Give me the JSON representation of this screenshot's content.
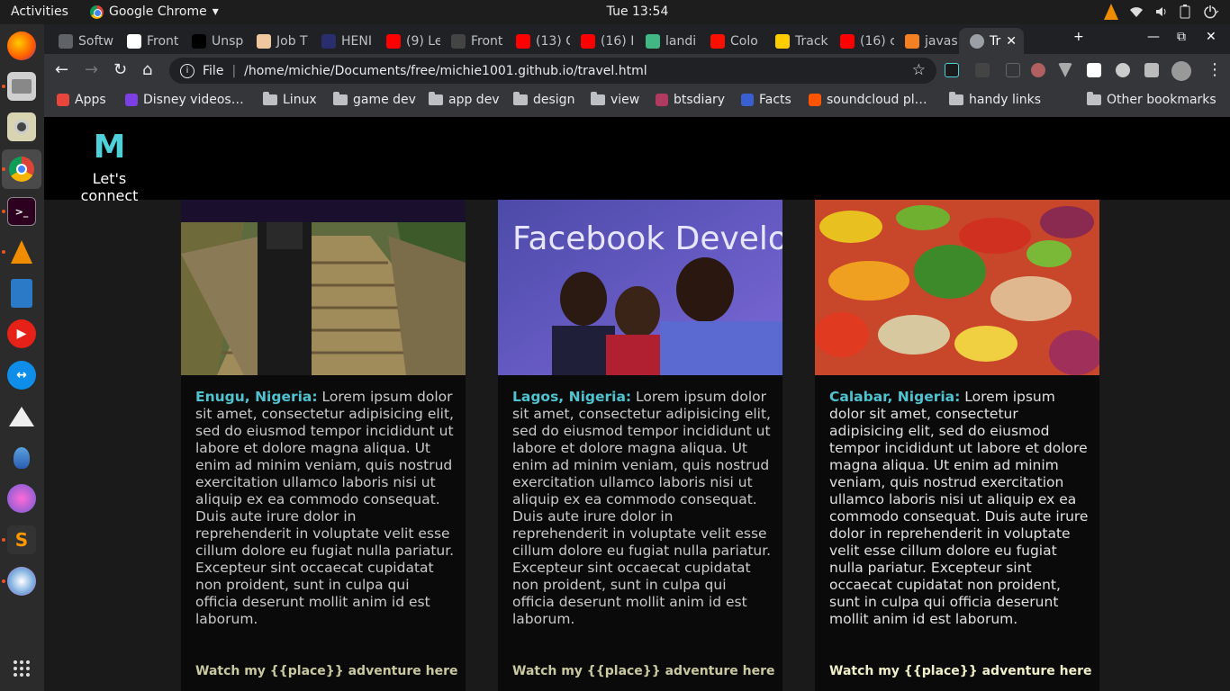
{
  "topbar": {
    "activities": "Activities",
    "app_name": "Google Chrome",
    "app_menu_arrow": "▾",
    "clock": "Tue 13:54"
  },
  "dock": {
    "items": [
      "firefox-icon",
      "files-icon",
      "rhythmbox-icon",
      "chrome-icon",
      "terminal-icon",
      "vlc-icon",
      "libreoffice-writer-icon",
      "youtube-music-icon",
      "teamviewer-icon",
      "inkscape-icon",
      "anydesk-icon",
      "gimp-icon",
      "sublime-text-icon",
      "gimp-alt-icon",
      "show-apps-icon"
    ]
  },
  "tabs": [
    {
      "label": "Softw",
      "color": "#5f6368"
    },
    {
      "label": "Front",
      "color": "#ffffff"
    },
    {
      "label": "Unsp",
      "color": "#000000"
    },
    {
      "label": "Job T",
      "color": "#f1c7a0"
    },
    {
      "label": "HENI",
      "color": "#2a2d6e"
    },
    {
      "label": "(9) Le",
      "color": "#ff0000"
    },
    {
      "label": "Front",
      "color": "#444444"
    },
    {
      "label": "(13) C",
      "color": "#ff0000"
    },
    {
      "label": "(16) I",
      "color": "#ff0000"
    },
    {
      "label": "landi",
      "color": "#41b883"
    },
    {
      "label": "Colo",
      "color": "#fa0f00"
    },
    {
      "label": "Track",
      "color": "#ffcc00"
    },
    {
      "label": "(16) c",
      "color": "#ff0000"
    },
    {
      "label": "javas",
      "color": "#f48024"
    },
    {
      "label": "Tr",
      "color": "#9aa0a6",
      "active": true
    }
  ],
  "tab_close": "✕",
  "new_tab": "+",
  "window_controls": {
    "minimize": "—",
    "restore": "⧉",
    "close": "✕"
  },
  "toolbar": {
    "back": "←",
    "forward": "→",
    "reload": "↻",
    "home": "⌂",
    "info": "i",
    "scheme": "File",
    "separator": "|",
    "url": "/home/michie/Documents/free/michie1001.github.io/travel.html",
    "star": "☆"
  },
  "bookmarks": [
    {
      "label": "Apps",
      "icon": "apps-grid-icon"
    },
    {
      "label": "Disney videos…",
      "icon": "disney-icon"
    },
    {
      "label": "Linux",
      "icon": "folder-icon"
    },
    {
      "label": "game dev",
      "icon": "folder-icon"
    },
    {
      "label": "app dev",
      "icon": "folder-icon"
    },
    {
      "label": "design",
      "icon": "folder-icon"
    },
    {
      "label": "view",
      "icon": "folder-icon"
    },
    {
      "label": "btsdiary",
      "icon": "btsdiary-icon"
    },
    {
      "label": "Facts",
      "icon": "facts-icon"
    },
    {
      "label": "soundcloud pl…",
      "icon": "soundcloud-icon"
    },
    {
      "label": "handy links",
      "icon": "folder-icon"
    },
    {
      "label": "Other bookmarks",
      "icon": "folder-icon"
    }
  ],
  "site": {
    "logo_letter": "M",
    "tagline": "Let's connect"
  },
  "cards": [
    {
      "place": "Enugu, Nigeria:",
      "body": " Lorem ipsum dolor sit amet, consectetur adipisicing elit, sed do eiusmod tempor incididunt ut labore et dolore magna aliqua. Ut enim ad minim veniam, quis nostrud exercitation ullamco laboris nisi ut aliquip ex ea commodo consequat. Duis aute irure dolor in reprehenderit in voluptate velit esse cillum dolore eu fugiat nulla pariatur. Excepteur sint occaecat cupidatat non proident, sunt in culpa qui officia deserunt mollit anim id est laborum.",
      "cta": "Watch my {{place}} adventure here",
      "photo_icon": "boardwalk-photo"
    },
    {
      "place": "Lagos, Nigeria:",
      "body": " Lorem ipsum dolor sit amet, consectetur adipisicing elit, sed do eiusmod tempor incididunt ut labore et dolore magna aliqua. Ut enim ad minim veniam, quis nostrud exercitation ullamco laboris nisi ut aliquip ex ea commodo consequat. Duis aute irure dolor in reprehenderit in voluptate velit esse cillum dolore eu fugiat nulla pariatur. Excepteur sint occaecat cupidatat non proident, sunt in culpa qui officia deserunt mollit anim id est laborum.",
      "cta": "Watch my {{place}} adventure here",
      "photo_text": "Facebook Develo",
      "photo_icon": "developers-meetup-photo"
    },
    {
      "place": "Calabar, Nigeria:",
      "body": " Lorem ipsum dolor sit amet, consectetur adipisicing elit, sed do eiusmod tempor incididunt ut labore et dolore magna aliqua. Ut enim ad minim veniam, quis nostrud exercitation ullamco laboris nisi ut aliquip ex ea commodo consequat. Duis aute irure dolor in reprehenderit in voluptate velit esse cillum dolore eu fugiat nulla pariatur. Excepteur sint occaecat cupidatat non proident, sunt in culpa qui officia deserunt mollit anim id est laborum.",
      "cta": "Watch my {{place}} adventure here",
      "photo_icon": "food-salad-photo"
    }
  ]
}
